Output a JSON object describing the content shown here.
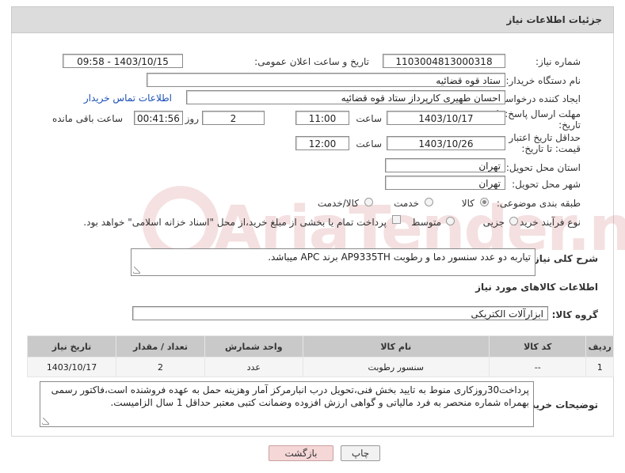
{
  "header": {
    "title": "جزئیات اطلاعات نیاز"
  },
  "fields": {
    "need_number_label": "شماره نیاز:",
    "need_number": "1103004813000318",
    "announce_label": "تاریخ و ساعت اعلان عمومی:",
    "announce_value": "1403/10/15 - 09:58",
    "buyer_org_label": "نام دستگاه خریدار:",
    "buyer_org": "ستاد قوه قضائیه",
    "creator_label": "ایجاد کننده درخواست:",
    "creator": "احسان طهیری کارپرداز ستاد قوه قضائیه",
    "contact_link": "اطلاعات تماس خریدار",
    "reply_deadline_label": "مهلت ارسال پاسخ: تا تاریخ:",
    "reply_date": "1403/10/17",
    "time_label": "ساعت",
    "reply_time": "11:00",
    "days_value": "2",
    "days_label": "روز و",
    "remaining_time": "00:41:56",
    "remaining_label": "ساعت باقی مانده",
    "validity_label": "حداقل تاریخ اعتبار قیمت: تا تاریخ:",
    "validity_date": "1403/10/26",
    "validity_time": "12:00",
    "province_label": "استان محل تحویل:",
    "province": "تهران",
    "city_label": "شهر محل تحویل:",
    "city": "تهران",
    "category_label": "طبقه بندی موضوعی:",
    "cat_goods": "کالا",
    "cat_service": "خدمت",
    "cat_goods_service": "کالا/خدمت",
    "process_label": "نوع فرآیند خرید :",
    "proc_partial": "جزیی",
    "proc_medium": "متوسط",
    "proc_treasury_note": "پرداخت تمام یا بخشی از مبلغ خرید،از محل \"اسناد خزانه اسلامی\" خواهد بود.",
    "description_label": "شرح کلی نیاز:",
    "description": "تیاربه دو عدد سنسور دما و رطوبت AP9335TH برند APC میباشد."
  },
  "goods_section": {
    "title": "اطلاعات کالاهای مورد نیاز",
    "group_label": "گروه کالا:",
    "group_value": "ابزارآلات الکتریکی"
  },
  "table": {
    "headers": [
      "ردیف",
      "کد کالا",
      "نام کالا",
      "واحد شمارش",
      "تعداد / مقدار",
      "تاریخ نیاز"
    ],
    "rows": [
      [
        "1",
        "--",
        "سنسور رطوبت",
        "عدد",
        "2",
        "1403/10/17"
      ]
    ]
  },
  "buyer_notes": {
    "label": "توضیحات خریدار:",
    "text": "پرداخت30روزکاری منوط به تایید بخش فنی،تحویل درب انبارمرکز آمار وهزینه حمل به عهده فروشنده است،فاکتور رسمی بهمراه شماره منحصر به فرد مالیاتی و گواهی ارزش افزوده وضمانت کتبی معتبر حداقل 1 سال الزامیست."
  },
  "buttons": {
    "print": "چاپ",
    "back": "بازگشت"
  },
  "watermark": {
    "text": "AriaTender.net"
  }
}
